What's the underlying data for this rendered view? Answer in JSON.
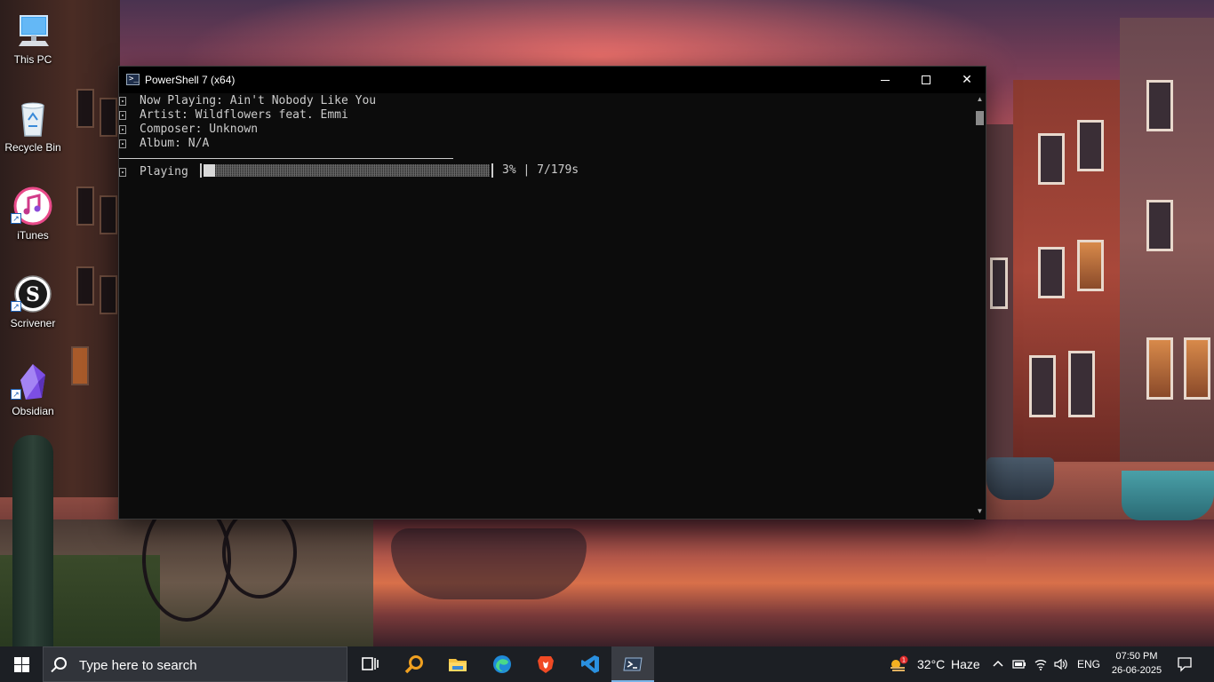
{
  "desktop": {
    "icons": [
      {
        "label": "This PC",
        "icon": "computer-icon"
      },
      {
        "label": "Recycle Bin",
        "icon": "recycle-bin-icon"
      },
      {
        "label": "iTunes",
        "icon": "itunes-icon"
      },
      {
        "label": "Scrivener",
        "icon": "scrivener-icon"
      },
      {
        "label": "Obsidian",
        "icon": "obsidian-icon"
      }
    ]
  },
  "window": {
    "title": "PowerShell 7 (x64)",
    "app_icon_glyph": ">_",
    "controls": {
      "minimize": "minimize-icon",
      "maximize": "maximize-icon",
      "close": "✕"
    }
  },
  "console": {
    "now_playing": "Now Playing: Ain't Nobody Like You",
    "artist": "Artist: Wildflowers feat. Emmi",
    "composer": "Composer: Unknown",
    "album": "Album: N/A",
    "state_label": "Playing",
    "progress_fraction": 0.039,
    "progress_text": "3% | 7/179s"
  },
  "taskbar": {
    "search_placeholder": "Type here to search",
    "apps": [
      "task-view-icon",
      "search-app-icon",
      "file-explorer-icon",
      "edge-icon",
      "brave-icon",
      "vscode-icon",
      "powershell-icon"
    ],
    "weather": {
      "temp": "32°C",
      "condition": "Haze",
      "badge": "1"
    },
    "language": "ENG",
    "time": "07:50 PM",
    "date": "26-06-2025"
  },
  "colors": {
    "terminal_bg": "#0c0c0c",
    "terminal_fg": "#cccccc",
    "taskbar_bg": "#1c1f24",
    "accent": "#7ab4e8"
  }
}
